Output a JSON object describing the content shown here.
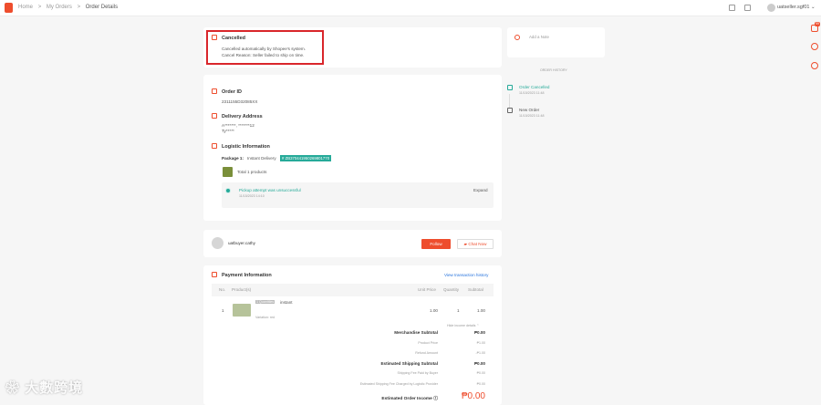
{
  "breadcrumb": {
    "home": "Home",
    "my_orders": "My Orders",
    "current": "Order Details",
    "sep": ">"
  },
  "topbar": {
    "username": "uatseller.sgf01"
  },
  "status": {
    "title": "Cancelled",
    "line1": "Cancelled automatically by Shopee's system.",
    "line2": "Cancel Reason: Seller failed to ship on time."
  },
  "order": {
    "id_label": "Order ID",
    "id_value": "2311155D32085XX",
    "address_label": "Delivery Address",
    "address_line1": "A*******, *******12",
    "address_line2": "Ty*****",
    "logistic_label": "Logistic Information",
    "package_label": "Package 1:",
    "package_type": "Instant Delivery",
    "tracking_tag": "# ZB370441950269801770",
    "total_products": "Total 1 products",
    "track_status": "Pickup attempt was unsuccessful",
    "track_time": "11/15/2023 14:10",
    "expand": "Expand"
  },
  "buyer": {
    "name": "uatbuyer.cathy",
    "follow": "Follow",
    "chat": "Chat Now"
  },
  "payment": {
    "title": "Payment Information",
    "view_link": "View transaction history",
    "headers": {
      "no": "No.",
      "product": "Product(s)",
      "unit_price": "Unit Price",
      "quantity": "Quantity",
      "subtotal": "Subtotal"
    },
    "row": {
      "no": "1",
      "tag": "1 Quantities",
      "name": "instant",
      "variation": "Variation: red",
      "unit_price": "1.00",
      "quantity": "1",
      "subtotal": "1.00"
    },
    "hide_details": "Hide income details",
    "summary": [
      {
        "label": "Merchandise Subtotal",
        "value": "₱0.00",
        "bold": true
      },
      {
        "label": "Product Price",
        "value": "₱1.00",
        "bold": false
      },
      {
        "label": "Refund Amount",
        "value": "-₱1.00",
        "bold": false
      },
      {
        "label": "Estimated Shipping Subtotal",
        "value": "₱0.00",
        "bold": true
      },
      {
        "label": "Shipping Fee Paid by Buyer",
        "value": "₱0.00",
        "bold": false
      },
      {
        "label": "Estimated Shipping Fee Charged by Logistic Provider",
        "value": "₱0.00",
        "bold": false
      }
    ],
    "income_label": "Estimated Order Income",
    "income_value": "₱0.00"
  },
  "notes": {
    "placeholder": "Add a Note"
  },
  "history": {
    "title": "ORDER HISTORY",
    "events": [
      {
        "label": "Order Cancelled",
        "time": "11/15/2023 11:48"
      },
      {
        "label": "New Order",
        "time": "11/15/2023 11:48"
      }
    ]
  },
  "sidebar_badge": "99",
  "watermark": "大數跨境",
  "colors": {
    "brand": "#ee4d2d",
    "teal": "#26aa99",
    "highlight": "#d9262b"
  }
}
